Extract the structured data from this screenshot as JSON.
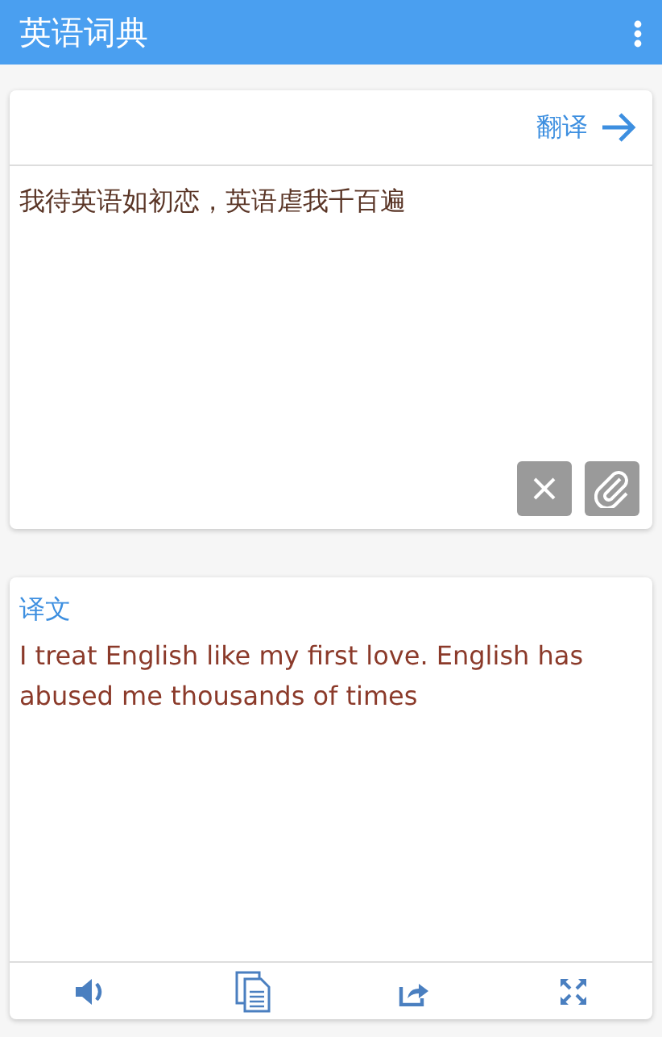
{
  "app_bar": {
    "title": "英语词典"
  },
  "input_card": {
    "translate_button": "翻译",
    "text": "我待英语如初恋，英语虐我千百遍"
  },
  "result_card": {
    "label": "译文",
    "text": "I treat English like my first love. English has abused me thousands of times"
  }
}
